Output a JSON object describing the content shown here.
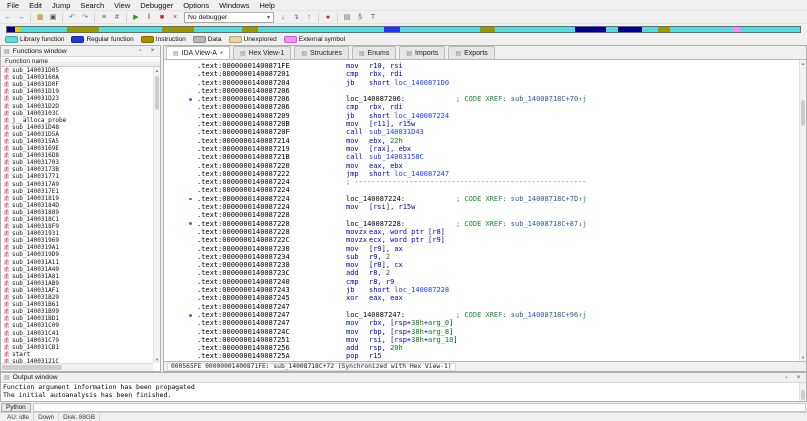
{
  "menubar": {
    "items": [
      {
        "label": "File"
      },
      {
        "label": "Edit"
      },
      {
        "label": "Jump"
      },
      {
        "label": "Search"
      },
      {
        "label": "View"
      },
      {
        "label": "Debugger"
      },
      {
        "label": "Options"
      },
      {
        "label": "Windows"
      },
      {
        "label": "Help"
      }
    ]
  },
  "toolbar": {
    "no_debugger_label": "No debugger",
    "icons_left": [
      {
        "n": "back-icon",
        "g": "←",
        "c": "#1d5bbf"
      },
      {
        "n": "forward-icon",
        "g": "→",
        "c": "#1d5bbf"
      },
      {
        "sep": true
      },
      {
        "n": "open-file-icon",
        "g": "▦",
        "c": "#b8860b"
      },
      {
        "n": "save-icon",
        "g": "▣",
        "c": "#4d4d4d"
      },
      {
        "sep": true
      },
      {
        "n": "jump-back-icon",
        "g": "↶",
        "c": "#777777"
      },
      {
        "n": "jump-forward-icon",
        "g": "↷",
        "c": "#777777"
      },
      {
        "sep": true
      },
      {
        "n": "search-text-icon",
        "g": "≡",
        "c": "#2e7d32"
      },
      {
        "n": "search-binary-icon",
        "g": "#",
        "c": "#2e7d32"
      },
      {
        "sep": true
      },
      {
        "n": "start-process-icon",
        "g": "▶",
        "c": "#1fa01f"
      },
      {
        "n": "pause-process-icon",
        "g": "‖",
        "c": "#d07000"
      },
      {
        "n": "stop-process-icon",
        "g": "■",
        "c": "#c02020"
      },
      {
        "n": "cancel-analysis-icon",
        "g": "×",
        "c": "#c02020"
      }
    ],
    "icons_right": [
      {
        "n": "step-into-icon",
        "g": "↓",
        "c": "#1d5bbf"
      },
      {
        "n": "step-over-icon",
        "g": "↴",
        "c": "#1d5bbf"
      },
      {
        "n": "run-until-return-icon",
        "g": "↑",
        "c": "#1d5bbf"
      },
      {
        "sep": true
      },
      {
        "n": "breakpoints-icon",
        "g": "●",
        "c": "#c02020"
      },
      {
        "sep": true
      },
      {
        "n": "segments-icon",
        "g": "▤",
        "c": "#666666"
      },
      {
        "n": "signatures-icon",
        "g": "§",
        "c": "#666666"
      },
      {
        "n": "type-libraries-icon",
        "g": "T",
        "c": "#666666"
      }
    ]
  },
  "navband": {
    "segments": [
      [
        "#000090",
        1
      ],
      [
        "#e0d000",
        0.6
      ],
      [
        "#55dddd",
        6
      ],
      [
        "#999900",
        4
      ],
      [
        "#55dddd",
        8
      ],
      [
        "#999900",
        4
      ],
      [
        "#55dddd",
        6
      ],
      [
        "#999900",
        2
      ],
      [
        "#55dddd",
        16
      ],
      [
        "#2233ff",
        2
      ],
      [
        "#55dddd",
        10
      ],
      [
        "#999900",
        2
      ],
      [
        "#55dddd",
        10
      ],
      [
        "#000090",
        4
      ],
      [
        "#55dddd",
        1.5
      ],
      [
        "#000090",
        3
      ],
      [
        "#55dddd",
        2
      ],
      [
        "#999900",
        1.5
      ],
      [
        "#55dddd",
        8
      ],
      [
        "#ff88ff",
        0.8
      ],
      [
        "#55dddd",
        7.6
      ]
    ]
  },
  "legend": {
    "items": [
      {
        "label": "Library function",
        "color": "#5cdede"
      },
      {
        "label": "Regular function",
        "color": "#2438d8"
      },
      {
        "label": "Instruction",
        "color": "#a89200"
      },
      {
        "label": "Data",
        "color": "#b8b8b8"
      },
      {
        "label": "Unexplored",
        "color": "#e8d8a0"
      },
      {
        "label": "External symbol",
        "color": "#ff8cff"
      }
    ]
  },
  "tabs": {
    "items": [
      {
        "label": "IDA View-A",
        "active": true
      },
      {
        "label": "Hex View-1",
        "active": false
      },
      {
        "label": "Structures",
        "active": false
      },
      {
        "label": "Enums",
        "active": false
      },
      {
        "label": "Imports",
        "active": false
      },
      {
        "label": "Exports",
        "active": false
      }
    ]
  },
  "functions_panel": {
    "title": "Functions window",
    "column_header": "Function name",
    "items": [
      "sub_140031D05",
      "sub_14003160A",
      "sub_140031D0F",
      "sub_140031D19",
      "sub_140031D23",
      "sub_140031D2D",
      "sub_14003103C",
      "j__alloca_probe",
      "sub_140031D48",
      "sub_140031D5A",
      "sub_1400315A5",
      "sub_14003169E",
      "sub_1400316D8",
      "sub_140031703",
      "sub_14003173B",
      "sub_140031771",
      "sub_1400317A9",
      "sub_1400317E1",
      "sub_140031819",
      "sub_14003184D",
      "sub_140031889",
      "sub_1400318C1",
      "sub_1400318F9",
      "sub_140031931",
      "sub_140031969",
      "sub_1400319A1",
      "sub_1400319D9",
      "sub_140031A11",
      "sub_140031A49",
      "sub_140031A81",
      "sub_140031AB9",
      "sub_140031AF1",
      "sub_140031B29",
      "sub_140031B61",
      "sub_140031B99",
      "sub_140031BD1",
      "sub_140031C09",
      "sub_140031C41",
      "sub_140031C79",
      "sub_140031CB1",
      "start",
      "sub_14003121C"
    ]
  },
  "disassembly": {
    "status_line": "000565FE 00000001400871FE: sub_14008718C+72 (Synchronized with Hex View-1)",
    "lines": [
      {
        "addr": ".text:00000001400871FE",
        "mnem": "mov",
        "ops": [
          [
            "o",
            "r10, rsi"
          ]
        ]
      },
      {
        "addr": ".text:0000000140087201",
        "mnem": "cmp",
        "ops": [
          [
            "o",
            "rbx, rdi"
          ]
        ]
      },
      {
        "addr": ".text:0000000140087204",
        "mnem": "jb",
        "ops": [
          [
            "k",
            "short "
          ],
          [
            "n",
            "loc_1400871D0"
          ]
        ]
      },
      {
        "addr": ".text:0000000140087206"
      },
      {
        "dot": true,
        "addr": ".text:0000000140087206",
        "label": "loc_140087206:",
        "cmt": [
          [
            "c",
            "; CODE XREF: "
          ],
          [
            "cn",
            "sub_14008718C+70"
          ],
          [
            "c",
            "↑j"
          ]
        ]
      },
      {
        "addr": ".text:0000000140087206",
        "mnem": "cmp",
        "ops": [
          [
            "o",
            "rbx, rdi"
          ]
        ]
      },
      {
        "addr": ".text:0000000140087209",
        "mnem": "jb",
        "ops": [
          [
            "k",
            "short "
          ],
          [
            "n",
            "loc_140087224"
          ]
        ]
      },
      {
        "addr": ".text:000000014008720B",
        "mnem": "mov",
        "ops": [
          [
            "o",
            "[r11], r15w"
          ]
        ]
      },
      {
        "addr": ".text:000000014008720F",
        "mnem": "call",
        "ops": [
          [
            "n",
            "sub_140031D43"
          ]
        ]
      },
      {
        "addr": ".text:0000000140087214",
        "mnem": "mov",
        "ops": [
          [
            "o",
            "ebx, "
          ],
          [
            "g",
            "22h"
          ]
        ]
      },
      {
        "addr": ".text:0000000140087219",
        "mnem": "mov",
        "ops": [
          [
            "o",
            "[rax], ebx"
          ]
        ]
      },
      {
        "addr": ".text:000000014008721B",
        "mnem": "call",
        "ops": [
          [
            "n",
            "sub_14003158C"
          ]
        ]
      },
      {
        "addr": ".text:0000000140087220",
        "mnem": "mov",
        "ops": [
          [
            "o",
            "eax, ebx"
          ]
        ]
      },
      {
        "addr": ".text:0000000140087222",
        "mnem": "jmp",
        "ops": [
          [
            "k",
            "short "
          ],
          [
            "n",
            "loc_140087247"
          ]
        ]
      },
      {
        "addr": ".text:0000000140087224",
        "sep": "; -------------------------------------------------------"
      },
      {
        "addr": ".text:0000000140087224"
      },
      {
        "dot": true,
        "addr": ".text:0000000140087224",
        "label": "loc_140087224:",
        "cmt": [
          [
            "c",
            "; CODE XREF: "
          ],
          [
            "cn",
            "sub_14008718C+7D"
          ],
          [
            "c",
            "↑j"
          ]
        ]
      },
      {
        "addr": ".text:0000000140087224",
        "mnem": "mov",
        "ops": [
          [
            "o",
            "[rsi], r15w"
          ]
        ]
      },
      {
        "addr": ".text:0000000140087228"
      },
      {
        "dot": true,
        "addr": ".text:0000000140087228",
        "label": "loc_140087228:",
        "cmt": [
          [
            "c",
            "; CODE XREF: "
          ],
          [
            "cn",
            "sub_14008718C+87"
          ],
          [
            "c",
            "↓j"
          ]
        ]
      },
      {
        "addr": ".text:0000000140087228",
        "mnem": "movzx",
        "ops": [
          [
            "o",
            "eax, "
          ],
          [
            "k",
            "word ptr "
          ],
          [
            "o",
            "[r8]"
          ]
        ]
      },
      {
        "addr": ".text:000000014008722C",
        "mnem": "movzx",
        "ops": [
          [
            "o",
            "ecx, "
          ],
          [
            "k",
            "word ptr "
          ],
          [
            "o",
            "[r9]"
          ]
        ]
      },
      {
        "addr": ".text:0000000140087230",
        "mnem": "mov",
        "ops": [
          [
            "o",
            "[r9], ax"
          ]
        ]
      },
      {
        "addr": ".text:0000000140087234",
        "mnem": "sub",
        "ops": [
          [
            "o",
            "r9, "
          ],
          [
            "g",
            "2"
          ]
        ]
      },
      {
        "addr": ".text:0000000140087238",
        "mnem": "mov",
        "ops": [
          [
            "o",
            "[r8], cx"
          ]
        ]
      },
      {
        "addr": ".text:000000014008723C",
        "mnem": "add",
        "ops": [
          [
            "o",
            "r8, "
          ],
          [
            "g",
            "2"
          ]
        ]
      },
      {
        "addr": ".text:0000000140087240",
        "mnem": "cmp",
        "ops": [
          [
            "o",
            "r8, r9"
          ]
        ]
      },
      {
        "addr": ".text:0000000140087243",
        "mnem": "jb",
        "ops": [
          [
            "k",
            "short "
          ],
          [
            "n",
            "loc_140087228"
          ]
        ]
      },
      {
        "addr": ".text:0000000140087245",
        "mnem": "xor",
        "ops": [
          [
            "o",
            "eax, eax"
          ]
        ]
      },
      {
        "addr": ".text:0000000140087247"
      },
      {
        "dot": true,
        "addr": ".text:0000000140087247",
        "label": "loc_140087247:",
        "cmt": [
          [
            "c",
            "; CODE XREF: "
          ],
          [
            "cn",
            "sub_14008718C+96"
          ],
          [
            "c",
            "↑j"
          ]
        ]
      },
      {
        "addr": ".text:0000000140087247",
        "mnem": "mov",
        "ops": [
          [
            "o",
            "rbx, [rsp+"
          ],
          [
            "g",
            "38h"
          ],
          [
            "o",
            "+"
          ],
          [
            "v",
            "arg_0"
          ],
          [
            "o",
            "]"
          ]
        ]
      },
      {
        "addr": ".text:000000014008724C",
        "mnem": "mov",
        "ops": [
          [
            "o",
            "rbp, [rsp+"
          ],
          [
            "g",
            "38h"
          ],
          [
            "o",
            "+"
          ],
          [
            "v",
            "arg_8"
          ],
          [
            "o",
            "]"
          ]
        ]
      },
      {
        "addr": ".text:0000000140087251",
        "mnem": "mov",
        "ops": [
          [
            "o",
            "rsi, [rsp+"
          ],
          [
            "g",
            "38h"
          ],
          [
            "o",
            "+"
          ],
          [
            "v",
            "arg_10"
          ],
          [
            "o",
            "]"
          ]
        ]
      },
      {
        "addr": ".text:0000000140087256",
        "mnem": "add",
        "ops": [
          [
            "o",
            "rsp, "
          ],
          [
            "g",
            "20h"
          ]
        ]
      },
      {
        "addr": ".text:000000014008725A",
        "mnem": "pop",
        "ops": [
          [
            "o",
            "r15"
          ]
        ]
      }
    ]
  },
  "output_window": {
    "title": "Output window",
    "lines": [
      "Function argument information has been propagated",
      "The initial autoanalysis has been finished."
    ]
  },
  "python_bar": {
    "label": "Python",
    "input_value": ""
  },
  "statusbar": {
    "items": [
      "AU: idle",
      "Down",
      "Disk: 88GB"
    ]
  },
  "icons": {
    "window": "▤",
    "dock": "▫",
    "close": "×",
    "combo_arrow": "▾",
    "scroll_up": "▲",
    "scroll_down": "▼",
    "f_marker": "f",
    "active_dot": "●"
  }
}
